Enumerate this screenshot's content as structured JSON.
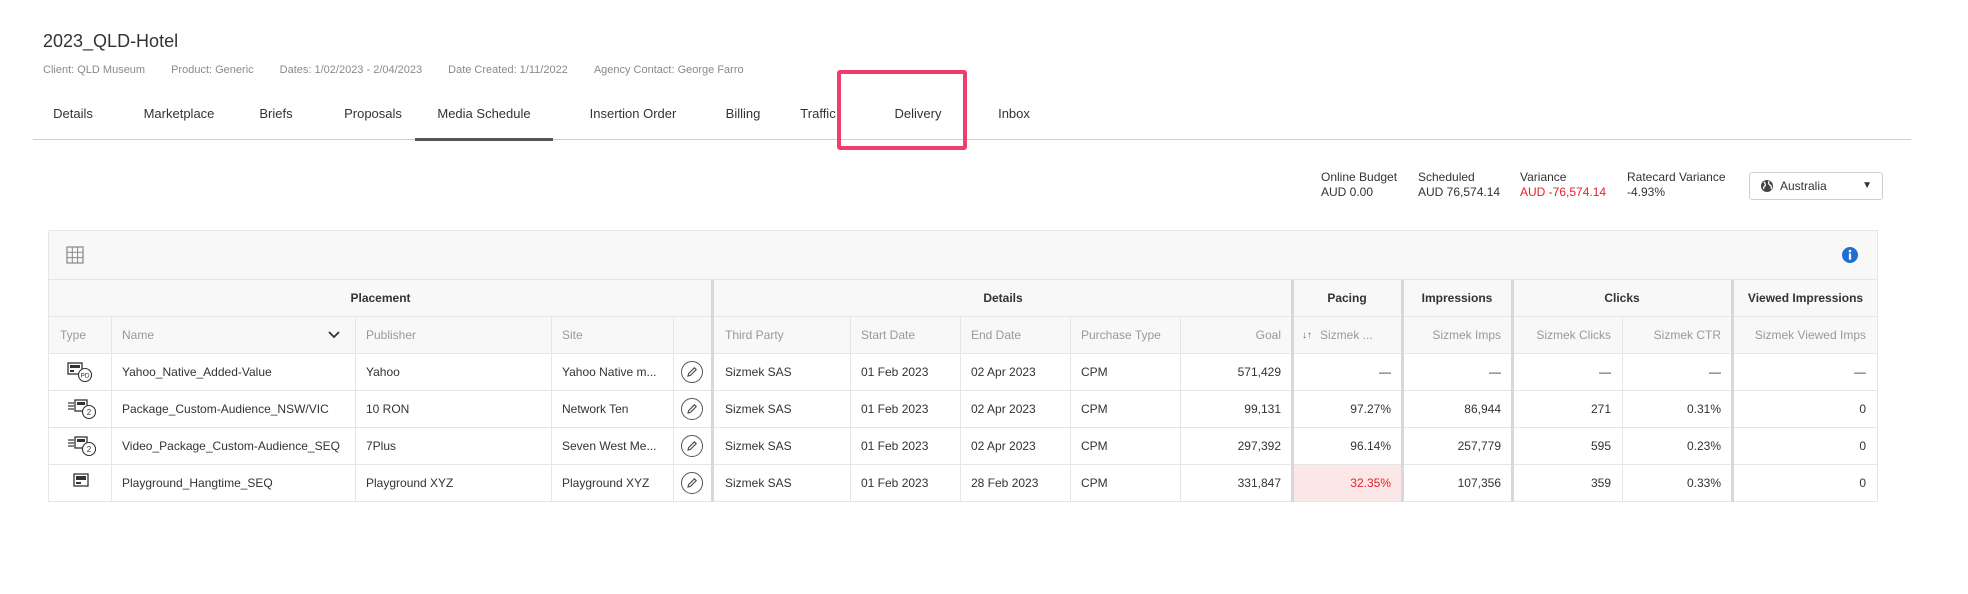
{
  "header": {
    "title": "2023_QLD-Hotel",
    "client": "Client: QLD Museum",
    "product": "Product: Generic",
    "dates": "Dates: 1/02/2023 - 2/04/2023",
    "date_created": "Date Created: 1/11/2022",
    "agency_contact": "Agency Contact: George Farro"
  },
  "tabs": [
    {
      "label": "Details"
    },
    {
      "label": "Marketplace"
    },
    {
      "label": "Briefs"
    },
    {
      "label": "Proposals"
    },
    {
      "label": "Media Schedule"
    },
    {
      "label": "Insertion Order"
    },
    {
      "label": "Billing"
    },
    {
      "label": "Traffic"
    },
    {
      "label": "Delivery"
    },
    {
      "label": "Inbox"
    }
  ],
  "active_tab": "Media Schedule",
  "highlighted_tab": "Delivery",
  "summary": {
    "online_budget_label": "Online Budget",
    "online_budget_value": "AUD 0.00",
    "scheduled_label": "Scheduled",
    "scheduled_value": "AUD 76,574.14",
    "variance_label": "Variance",
    "variance_value": "AUD -76,574.14",
    "ratecard_variance_label": "Ratecard Variance",
    "ratecard_variance_value": "-4.93%"
  },
  "region_select": {
    "value": "Australia"
  },
  "table": {
    "groups": {
      "placement": "Placement",
      "details": "Details",
      "pacing": "Pacing",
      "impressions": "Impressions",
      "clicks": "Clicks",
      "viewed": "Viewed Impressions"
    },
    "columns": {
      "type": "Type",
      "name": "Name",
      "publisher": "Publisher",
      "site": "Site",
      "third_party": "Third Party",
      "start_date": "Start Date",
      "end_date": "End Date",
      "purchase_type": "Purchase Type",
      "goal": "Goal",
      "pacing": "Sizmek ...",
      "imps": "Sizmek Imps",
      "clicks": "Sizmek Clicks",
      "ctr": "Sizmek CTR",
      "viewed": "Sizmek Viewed Imps"
    },
    "rows": [
      {
        "type_icon": "pd-package-icon",
        "type_badge": "PD",
        "name": "Yahoo_Native_Added-Value",
        "publisher": "Yahoo",
        "site": "Yahoo Native m...",
        "third_party": "Sizmek SAS",
        "start": "01 Feb 2023",
        "end": "02 Apr 2023",
        "purchase": "CPM",
        "goal": "571,429",
        "pacing": "—",
        "imps": "—",
        "clicks": "—",
        "ctr": "—",
        "viewed": "—"
      },
      {
        "type_icon": "package-icon",
        "type_badge": "2",
        "name": "Package_Custom-Audience_NSW/VIC",
        "publisher": "10 RON",
        "site": "Network Ten",
        "third_party": "Sizmek SAS",
        "start": "01 Feb 2023",
        "end": "02 Apr 2023",
        "purchase": "CPM",
        "goal": "99,131",
        "pacing": "97.27%",
        "imps": "86,944",
        "clicks": "271",
        "ctr": "0.31%",
        "viewed": "0"
      },
      {
        "type_icon": "package-icon",
        "type_badge": "2",
        "name": "Video_Package_Custom-Audience_SEQ",
        "publisher": "7Plus",
        "site": "Seven West Me...",
        "third_party": "Sizmek SAS",
        "start": "01 Feb 2023",
        "end": "02 Apr 2023",
        "purchase": "CPM",
        "goal": "297,392",
        "pacing": "96.14%",
        "imps": "257,779",
        "clicks": "595",
        "ctr": "0.23%",
        "viewed": "0"
      },
      {
        "type_icon": "display-icon",
        "type_badge": "",
        "name": "Playground_Hangtime_SEQ",
        "publisher": "Playground XYZ",
        "site": "Playground XYZ",
        "third_party": "Sizmek SAS",
        "start": "01 Feb 2023",
        "end": "28 Feb 2023",
        "purchase": "CPM",
        "goal": "331,847",
        "pacing": "32.35%",
        "pacing_alert": true,
        "imps": "107,356",
        "clicks": "359",
        "ctr": "0.33%",
        "viewed": "0"
      }
    ]
  },
  "colors": {
    "highlight": "#ef3e6e",
    "negative": "#e8202a",
    "pacing_alert_bg": "#fbe7e7",
    "info_blue": "#1f6fd1"
  }
}
